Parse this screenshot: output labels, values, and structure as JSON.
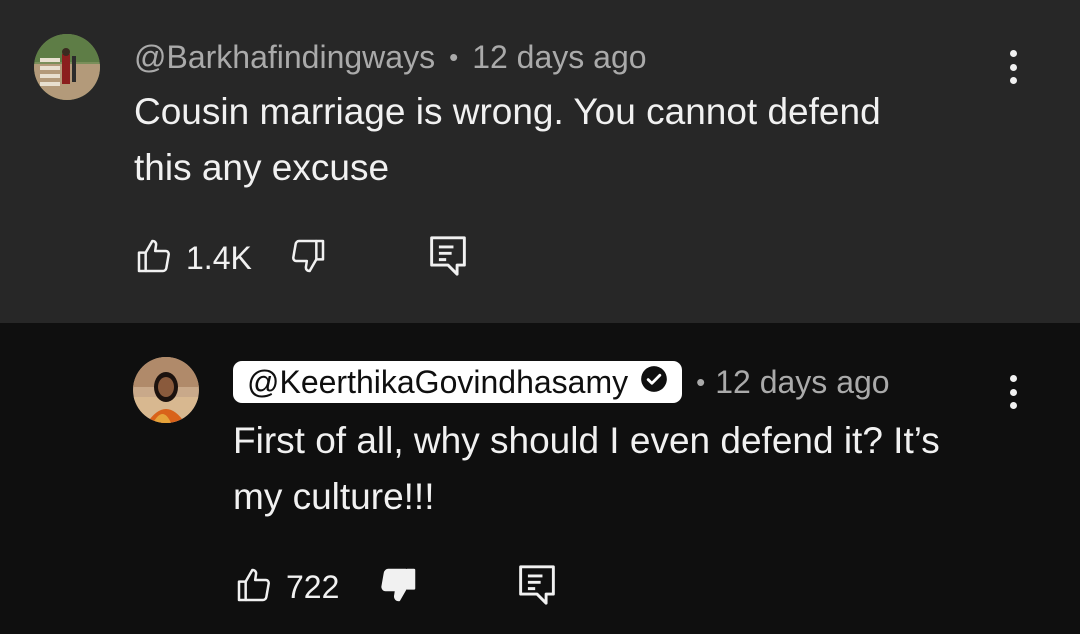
{
  "comments": [
    {
      "handle": "@Barkhafindingways",
      "separator": "•",
      "time": "12 days ago",
      "text_lines": [
        "Cousin marriage is wrong. You cannot defend",
        "this any excuse"
      ],
      "like_count": "1.4K"
    },
    {
      "handle": "@KeerthikaGovindhasamy",
      "separator": "•",
      "time": "12 days ago",
      "text_lines": [
        "First of all, why should I even defend it? It’s",
        "my culture!!!"
      ],
      "like_count": "722"
    }
  ],
  "icons": {
    "like": "thumbs-up-icon",
    "dislike": "thumbs-down-icon",
    "reply": "reply-comment-icon",
    "more": "more-vertical-icon",
    "verified": "verified-check-icon"
  },
  "colors": {
    "top_background": "#272727",
    "reply_background": "#0f0f0f",
    "meta_text": "#aaaaaa",
    "handle_pill": "#ffffff"
  }
}
